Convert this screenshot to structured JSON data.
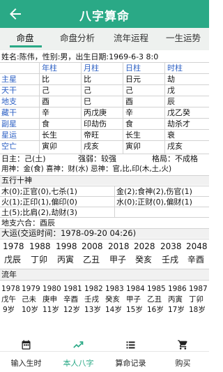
{
  "app": {
    "title": "八字算命"
  },
  "tabs": [
    {
      "label": "命盘"
    },
    {
      "label": "命盘分析"
    },
    {
      "label": "流年运程"
    },
    {
      "label": "一生运势"
    }
  ],
  "profile": {
    "line": "姓名:陈伟，性别:男，出生日期:1969-6-3 8:0"
  },
  "pillars": {
    "headers": [
      "年柱",
      "月柱",
      "日柱",
      "时柱"
    ],
    "rows": [
      {
        "label": "主星",
        "cells": [
          "比",
          "比",
          "日元",
          "劫"
        ]
      },
      {
        "label": "天干",
        "cells": [
          "己",
          "己",
          "己",
          "戊"
        ]
      },
      {
        "label": "地支",
        "cells": [
          "酉",
          "巳",
          "酉",
          "辰"
        ]
      },
      {
        "label": "藏干",
        "cells": [
          "辛",
          "丙戊庚",
          "辛",
          "戊乙癸"
        ]
      },
      {
        "label": "副星",
        "cells": [
          "食",
          "印劫伤",
          "食",
          "劫杀才"
        ]
      },
      {
        "label": "星运",
        "cells": [
          "长生",
          "帝旺",
          "长生",
          "衰"
        ]
      },
      {
        "label": "空亡",
        "cells": [
          "寅卯",
          "戌亥",
          "寅卯",
          "戌亥"
        ]
      }
    ]
  },
  "summary": {
    "day_master": "日主：己(土)",
    "strength": "强弱：较强",
    "pattern": "格局：不成格",
    "gods": "用神：金(食) 喜神：财(水) 忌神：官,比,印(木,土,火)"
  },
  "wuxing": {
    "title": "五行十神",
    "items": [
      "木(0);正官(0),七杀(1)",
      "金(2);食神(2),伤官(1)",
      "火(1);正印(1),偏印(0)",
      "水(0);正财(0),偏财(1)",
      "土(5);比肩(2),劫财(3)"
    ],
    "liuhe": "地支六合：酉辰"
  },
  "dayun": {
    "title": "大运(交运时间：1978-09-20 04:26)",
    "years": [
      "1978",
      "1988",
      "1998",
      "2008",
      "2018",
      "2028",
      "2038",
      "2048"
    ],
    "ganzhi": [
      "戊辰",
      "丁卯",
      "丙寅",
      "乙丑",
      "甲子",
      "癸亥",
      "壬戌",
      "辛酉"
    ]
  },
  "liunian": {
    "title": "流年",
    "years": [
      "1978",
      "1979",
      "1980",
      "1981",
      "1982",
      "1983",
      "1984",
      "1985",
      "1986",
      "1987"
    ],
    "ganzhi": [
      "戊午",
      "己未",
      "庚申",
      "辛酉",
      "壬戌",
      "癸亥",
      "甲子",
      "乙丑",
      "丙寅",
      "丁卯"
    ],
    "ages": [
      "9岁",
      "10岁",
      "11岁",
      "12岁",
      "13岁",
      "14岁",
      "15岁",
      "16岁",
      "17岁",
      "18岁"
    ]
  },
  "bottom_nav": [
    {
      "label": "输入生时",
      "icon": "calendar-icon"
    },
    {
      "label": "本人八字",
      "icon": "trend-icon"
    },
    {
      "label": "算命记录",
      "icon": "list-icon"
    },
    {
      "label": "购买",
      "icon": "cart-icon"
    }
  ],
  "colors": {
    "brand": "#2aa986",
    "blue": "#2e61c4",
    "red": "#c72a2a"
  }
}
